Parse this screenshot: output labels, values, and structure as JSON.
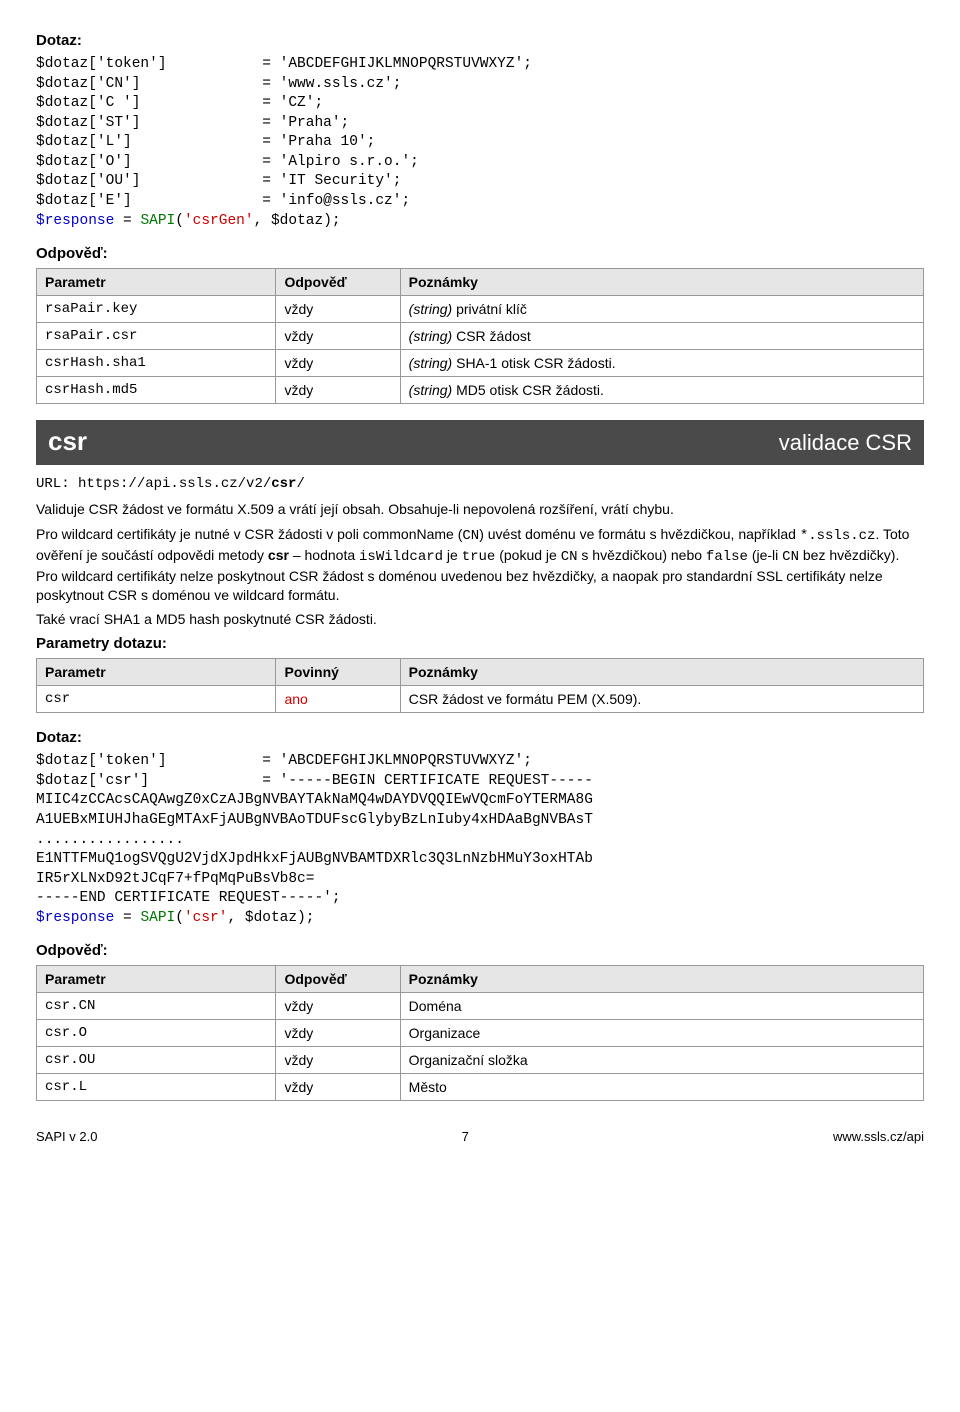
{
  "dotaz1": {
    "heading": "Dotaz:",
    "lines_html": [
      "$dotaz['token']           = 'ABCDEFGHIJKLMNOPQRSTUVWXYZ';",
      "$dotaz['CN']              = 'www.ssls.cz';",
      "$dotaz['C ']              = 'CZ';",
      "$dotaz['ST']              = 'Praha';",
      "$dotaz['L']               = 'Praha 10';",
      "$dotaz['O']               = 'Alpiro s.r.o.';",
      "$dotaz['OU']              = 'IT Security';",
      "$dotaz['E']               = 'info@ssls.cz';"
    ],
    "call_prefix": "$response",
    "call_eq": " = ",
    "call_func": "SAPI",
    "call_open": "(",
    "call_arg1": "'csrGen'",
    "call_rest": ", $dotaz);"
  },
  "odpoved1": {
    "heading": "Odpověď:",
    "col1": "Parametr",
    "col2": "Odpověď",
    "col3": "Poznámky",
    "rows": [
      {
        "p": "rsaPair.key",
        "o": "vždy",
        "n_prefix": "(string)",
        "n_rest": " privátní klíč"
      },
      {
        "p": "rsaPair.csr",
        "o": "vždy",
        "n_prefix": "(string)",
        "n_rest": " CSR žádost"
      },
      {
        "p": "csrHash.sha1",
        "o": "vždy",
        "n_prefix": "(string)",
        "n_rest": " SHA-1 otisk CSR žádosti."
      },
      {
        "p": "csrHash.md5",
        "o": "vždy",
        "n_prefix": "(string)",
        "n_rest": " MD5 otisk CSR žádosti."
      }
    ]
  },
  "method_bar": {
    "left": "csr",
    "right": "validace CSR"
  },
  "section2": {
    "url_label": "URL: ",
    "url_plain": "https://api.ssls.cz/v2/",
    "url_bold": "csr",
    "url_tail": "/",
    "p1": "Validuje CSR žádost ve formátu X.509 a vrátí její obsah. Obsahuje-li nepovolená rozšíření, vrátí chybu.",
    "p2a": "Pro wildcard certifikáty je nutné v CSR žádosti v poli commonName (",
    "p2b_mono": "CN",
    "p2c": ") uvést doménu ve formátu s hvězdičkou, například ",
    "p2d_mono": "*.ssls.cz",
    "p2e": ". Toto ověření je součástí odpovědi metody ",
    "p2f_bold": "csr",
    "p2g": " – hodnota ",
    "p2h_mono": "isWildcard",
    "p2i": " je ",
    "p2j_mono": "true",
    "p2k": " (pokud je ",
    "p2l_mono": "CN",
    "p2m": " s hvězdičkou) nebo ",
    "p2n_mono": "false",
    "p2o": " (je-li ",
    "p2p_mono": "CN",
    "p2q": " bez hvězdičky). Pro wildcard certifikáty nelze poskytnout CSR žádost s doménou uvedenou bez hvězdičky, a naopak pro standardní SSL certifikáty nelze poskytnout CSR s doménou ve wildcard formátu.",
    "p3": "Také vrací SHA1 a MD5 hash poskytnuté CSR žádosti.",
    "params_heading": "Parametry dotazu:",
    "col1": "Parametr",
    "col2": "Povinný",
    "col3": "Poznámky",
    "row": {
      "p": "csr",
      "req": "ano",
      "n": "CSR žádost ve formátu PEM (X.509)."
    }
  },
  "dotaz2": {
    "heading": "Dotaz:",
    "l1": "$dotaz['token']           = 'ABCDEFGHIJKLMNOPQRSTUVWXYZ';",
    "l2": "$dotaz['csr']             = '-----BEGIN CERTIFICATE REQUEST-----",
    "l3": "MIIC4zCCAcsCAQAwgZ0xCzAJBgNVBAYTAkNaMQ4wDAYDVQQIEwVQcmFoYTERMA8G",
    "l4": "A1UEBxMIUHJhaGEgMTAxFjAUBgNVBAoTDUFscGlybyBzLnIuby4xHDAaBgNVBAsT",
    "l5": ".................",
    "l6": "E1NTTFMuQ1ogSVQgU2VjdXJpdHkxFjAUBgNVBAMTDXRlc3Q3LnNzbHMuY3oxHTAb",
    "l7": "IR5rXLNxD92tJCqF7+fPqMqPuBsVb8c=",
    "l8": "-----END CERTIFICATE REQUEST-----';",
    "call_prefix": "$response",
    "call_eq": " = ",
    "call_func": "SAPI",
    "call_open": "(",
    "call_arg1": "'csr'",
    "call_rest": ", $dotaz);"
  },
  "odpoved2": {
    "heading": "Odpověď:",
    "col1": "Parametr",
    "col2": "Odpověď",
    "col3": "Poznámky",
    "rows": [
      {
        "p": "csr.CN",
        "o": "vždy",
        "n": "Doména"
      },
      {
        "p": "csr.O",
        "o": "vždy",
        "n": "Organizace"
      },
      {
        "p": "csr.OU",
        "o": "vždy",
        "n": "Organizační složka"
      },
      {
        "p": "csr.L",
        "o": "vždy",
        "n": "Město"
      }
    ]
  },
  "footer": {
    "left": "SAPI v 2.0",
    "center": "7",
    "right": "www.ssls.cz/api"
  }
}
